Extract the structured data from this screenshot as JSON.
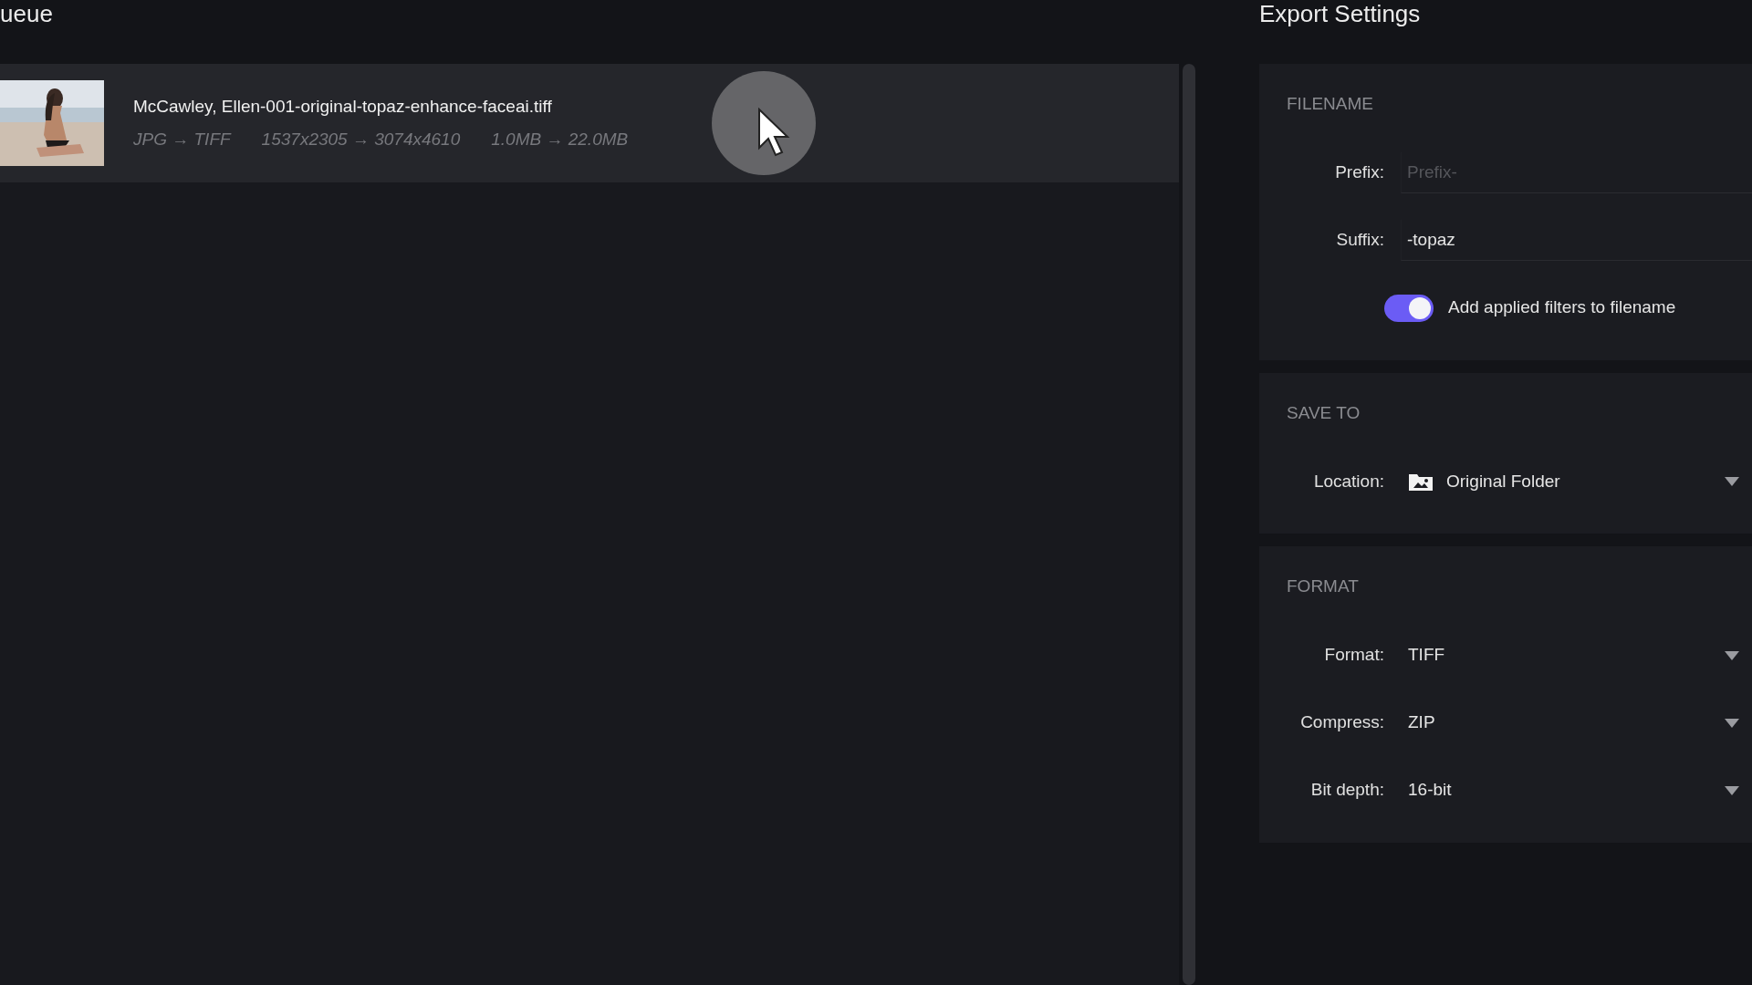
{
  "queue_panel": {
    "title": "ueue",
    "items": [
      {
        "filename": "McCawley, Ellen-001-original-topaz-enhance-faceai.tiff",
        "formats": "JPG → TIFF",
        "dimensions": "1537x2305 → 3074x4610",
        "sizes": "1.0MB → 22.0MB",
        "selected": true
      }
    ]
  },
  "export_settings": {
    "title": "Export Settings",
    "sections": [
      {
        "heading": "FILENAME",
        "rows": [
          {
            "kind": "text",
            "label": "Prefix:",
            "placeholder": "Prefix-"
          },
          {
            "kind": "text",
            "label": "Suffix:",
            "value": "-topaz"
          },
          {
            "kind": "toggle",
            "label": "Add applied filters to filename",
            "on": true
          }
        ]
      },
      {
        "heading": "SAVE TO",
        "rows": [
          {
            "kind": "folder-select",
            "label": "Location:",
            "value": "Original Folder"
          }
        ]
      },
      {
        "heading": "FORMAT",
        "rows": [
          {
            "kind": "select",
            "label": "Format:",
            "value": "TIFF"
          },
          {
            "kind": "select",
            "label": "Compress:",
            "value": "ZIP"
          },
          {
            "kind": "select",
            "label": "Bit depth:",
            "value": "16-bit"
          }
        ]
      }
    ]
  }
}
